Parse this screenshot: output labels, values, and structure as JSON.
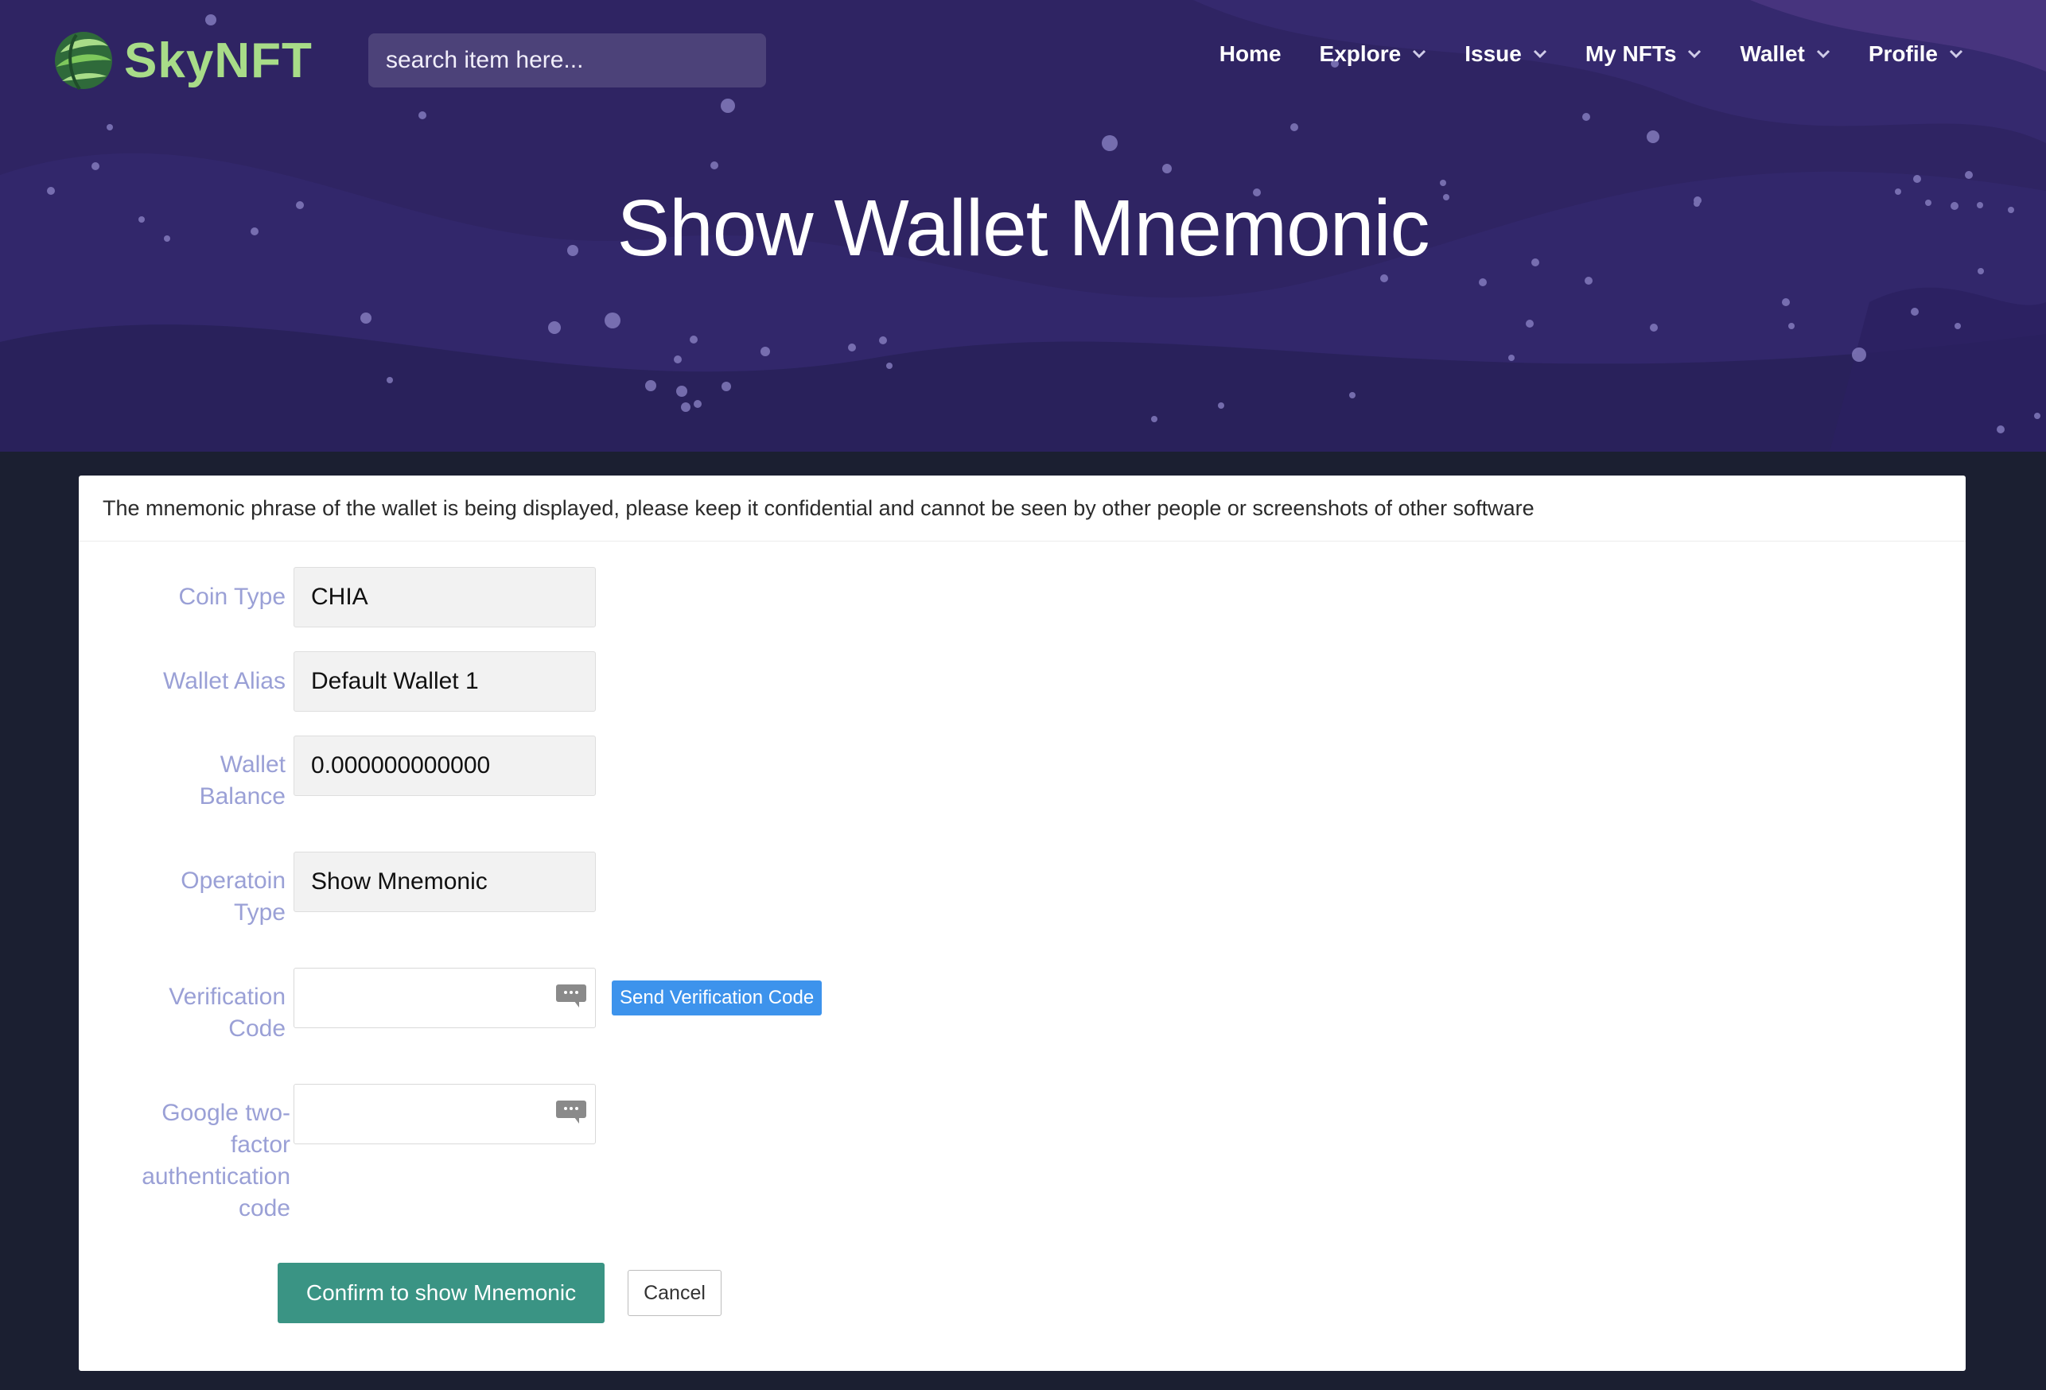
{
  "brand": {
    "name": "SkyNFT"
  },
  "search": {
    "placeholder": "search item here..."
  },
  "nav": {
    "home": "Home",
    "explore": "Explore",
    "issue": "Issue",
    "my_nfts": "My NFTs",
    "wallet": "Wallet",
    "profile": "Profile"
  },
  "page": {
    "title": "Show Wallet Mnemonic"
  },
  "notice": "The mnemonic phrase of the wallet is being displayed, please keep it confidential and cannot be seen by other people or screenshots of other software",
  "form": {
    "coin_type": {
      "label": "Coin Type",
      "value": "CHIA"
    },
    "wallet_alias": {
      "label": "Wallet Alias",
      "value": "Default Wallet 1"
    },
    "wallet_balance": {
      "label_line1": "Wallet",
      "label_line2": "Balance",
      "value": "0.000000000000"
    },
    "operation_type": {
      "label_line1": "Operatoin",
      "label_line2": "Type",
      "value": "Show Mnemonic"
    },
    "verification_code": {
      "label_line1": "Verification",
      "label_line2": "Code",
      "value": ""
    },
    "send_code_button": "Send Verification Code",
    "google_2fa": {
      "label_line1": "Google two-",
      "label_line2": "factor",
      "label_line3": "authentication",
      "label_line4": "code",
      "value": ""
    }
  },
  "actions": {
    "confirm": "Confirm to show Mnemonic",
    "cancel": "Cancel"
  },
  "colors": {
    "hero_bg": "#2f2463",
    "page_bg": "#1b1f31",
    "label": "#9aa0d6",
    "primary_button": "#3a9484",
    "send_button": "#3d93ec",
    "logo_green": "#a8dc88"
  },
  "icons": {
    "logo": "leaf-globe-logo",
    "dropdown": "chevron-down-icon",
    "field_helper": "chat-bubble-icon"
  }
}
